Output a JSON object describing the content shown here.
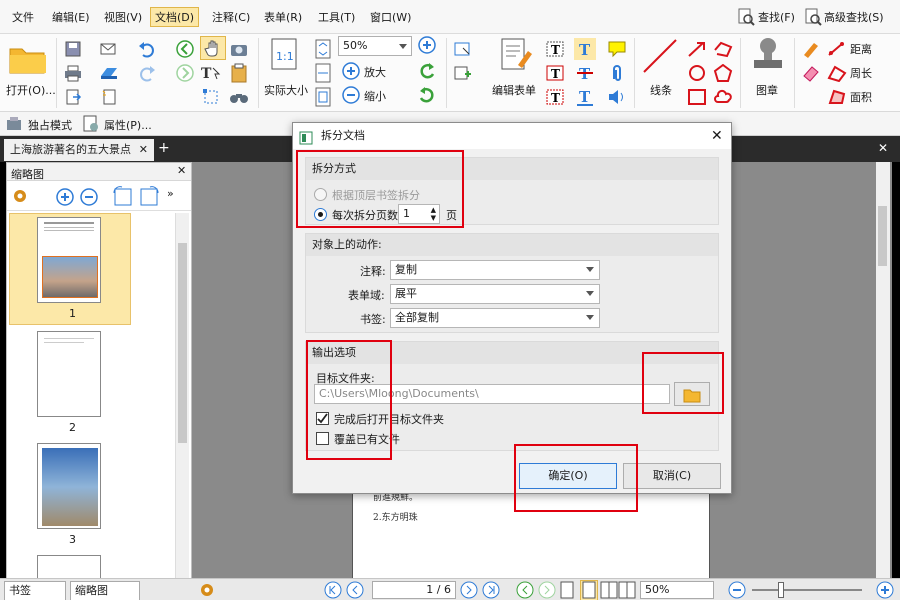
{
  "menu": {
    "items": [
      "文件",
      "编辑(E)",
      "视图(V)",
      "文档(D)",
      "注释(C)",
      "表单(R)",
      "工具(T)",
      "窗口(W)"
    ],
    "find": "查找(F)",
    "advanced_find": "高级查找(S)"
  },
  "ribbon": {
    "open": "打开(O)...",
    "zoom_value": "50%",
    "actual_size": "实际大小",
    "zoom_in": "放大",
    "zoom_out": "缩小",
    "edit_form": "编辑表单",
    "line": "线条",
    "stamp": "图章",
    "distance": "距离",
    "perimeter": "周长",
    "area": "面积"
  },
  "subbar": {
    "exclusive_mode": "独占模式",
    "properties": "属性(P)..."
  },
  "tabs": {
    "document": "上海旅游著名的五大景点"
  },
  "thumbnails": {
    "title": "缩略图",
    "pages": [
      "1",
      "2",
      "3"
    ]
  },
  "bottom": {
    "tab_bookmarks": "书签",
    "tab_thumbnails": "缩略图",
    "page_indicator": "1 / 6",
    "zoom_value": "50%"
  },
  "document_snippet": {
    "line1": "前進規鮮。",
    "line2": "2.东方明珠"
  },
  "dialog": {
    "title": "拆分文档",
    "split_method": {
      "heading": "拆分方式",
      "by_bookmarks": "根据顶层书签拆分",
      "by_pages": "每次拆分页数",
      "pages_value": "1",
      "pages_unit": "页"
    },
    "object_actions": {
      "heading": "对象上的动作:",
      "annotations_label": "注释:",
      "annotations_value": "复制",
      "form_fields_label": "表单域:",
      "form_fields_value": "展平",
      "bookmarks_label": "书签:",
      "bookmarks_value": "全部复制"
    },
    "output": {
      "heading": "输出选项",
      "folder_label": "目标文件夹:",
      "folder_value": "C:\\Users\\Mloong\\Documents\\",
      "open_after": "完成后打开目标文件夹",
      "open_after_checked": true,
      "overwrite": "覆盖已有文件",
      "overwrite_checked": false
    },
    "ok": "确定(O)",
    "cancel": "取消(C)"
  },
  "colors": {
    "highlight_red": "#e0000f",
    "active_menu": "#fce8a8",
    "accent_blue": "#2e7bd6"
  }
}
